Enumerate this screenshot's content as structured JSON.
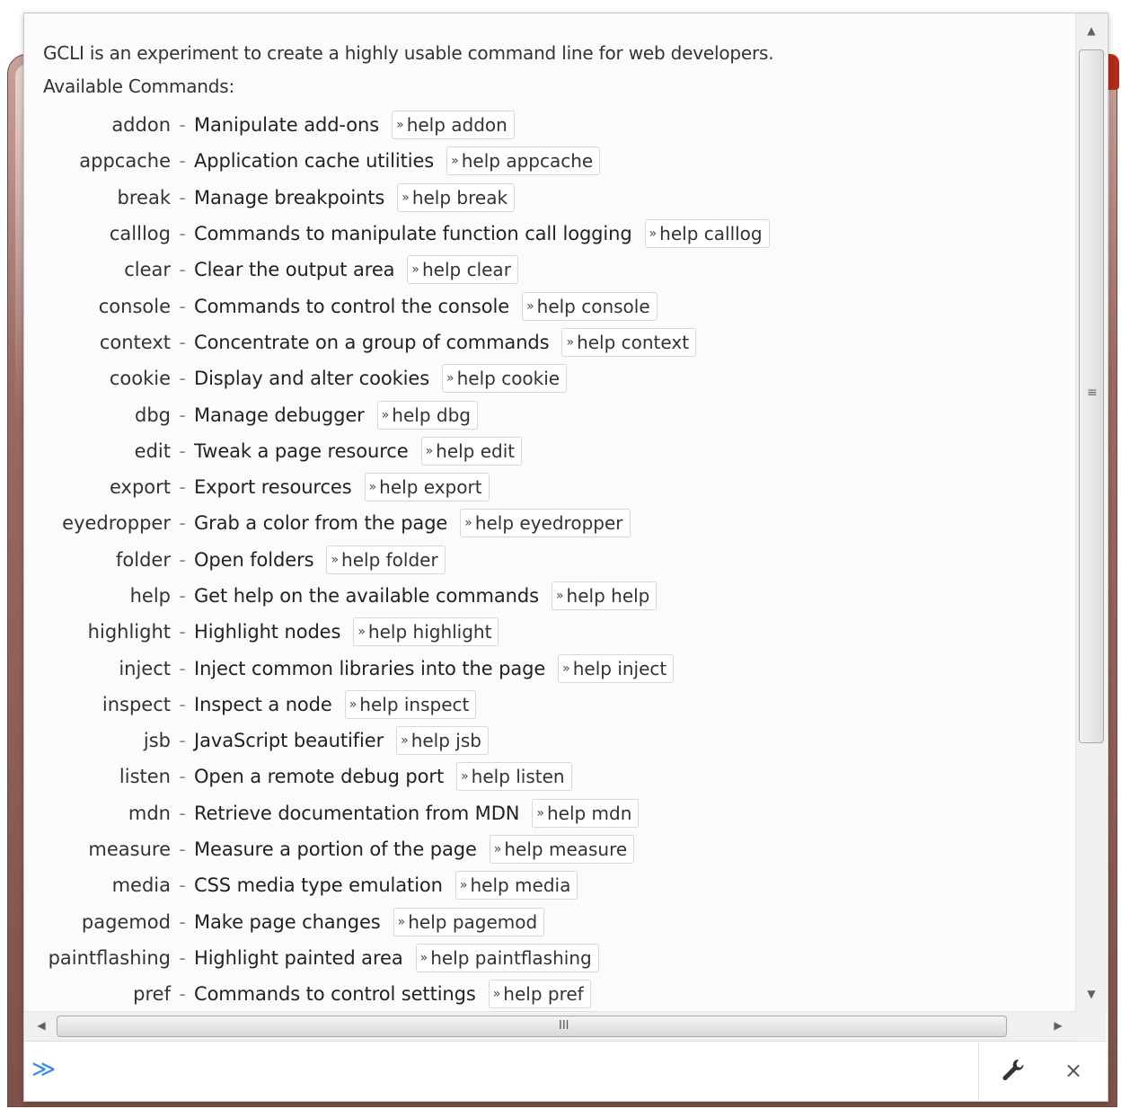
{
  "intro": {
    "line1": "GCLI is an experiment to create a highly usable command line for web developers.",
    "line2": "Available Commands:"
  },
  "commands": [
    {
      "name": "addon",
      "desc": "Manipulate add-ons",
      "help": "help addon"
    },
    {
      "name": "appcache",
      "desc": "Application cache utilities",
      "help": "help appcache"
    },
    {
      "name": "break",
      "desc": "Manage breakpoints",
      "help": "help break"
    },
    {
      "name": "calllog",
      "desc": "Commands to manipulate function call logging",
      "help": "help calllog"
    },
    {
      "name": "clear",
      "desc": "Clear the output area",
      "help": "help clear"
    },
    {
      "name": "console",
      "desc": "Commands to control the console",
      "help": "help console"
    },
    {
      "name": "context",
      "desc": "Concentrate on a group of commands",
      "help": "help context"
    },
    {
      "name": "cookie",
      "desc": "Display and alter cookies",
      "help": "help cookie"
    },
    {
      "name": "dbg",
      "desc": "Manage debugger",
      "help": "help dbg"
    },
    {
      "name": "edit",
      "desc": "Tweak a page resource",
      "help": "help edit"
    },
    {
      "name": "export",
      "desc": "Export resources",
      "help": "help export"
    },
    {
      "name": "eyedropper",
      "desc": "Grab a color from the page",
      "help": "help eyedropper"
    },
    {
      "name": "folder",
      "desc": "Open folders",
      "help": "help folder"
    },
    {
      "name": "help",
      "desc": "Get help on the available commands",
      "help": "help help"
    },
    {
      "name": "highlight",
      "desc": "Highlight nodes",
      "help": "help highlight"
    },
    {
      "name": "inject",
      "desc": "Inject common libraries into the page",
      "help": "help inject"
    },
    {
      "name": "inspect",
      "desc": "Inspect a node",
      "help": "help inspect"
    },
    {
      "name": "jsb",
      "desc": "JavaScript beautifier",
      "help": "help jsb"
    },
    {
      "name": "listen",
      "desc": "Open a remote debug port",
      "help": "help listen"
    },
    {
      "name": "mdn",
      "desc": "Retrieve documentation from MDN",
      "help": "help mdn"
    },
    {
      "name": "measure",
      "desc": "Measure a portion of the page",
      "help": "help measure"
    },
    {
      "name": "media",
      "desc": "CSS media type emulation",
      "help": "help media"
    },
    {
      "name": "pagemod",
      "desc": "Make page changes",
      "help": "help pagemod"
    },
    {
      "name": "paintflashing",
      "desc": "Highlight painted area",
      "help": "help paintflashing"
    },
    {
      "name": "pref",
      "desc": "Commands to control settings",
      "help": "help pref"
    }
  ],
  "separator": "-",
  "help_chevron": "»",
  "input": {
    "prompt": "≫",
    "value": "",
    "placeholder": ""
  },
  "icons": {
    "settings": "wrench-icon",
    "close": "close-icon",
    "close_glyph": "×"
  },
  "scrollbar_grip": {
    "vertical": "≡",
    "horizontal": "III"
  },
  "colors": {
    "prompt": "#3a8ee6",
    "frame_red": "#b42b1c"
  }
}
